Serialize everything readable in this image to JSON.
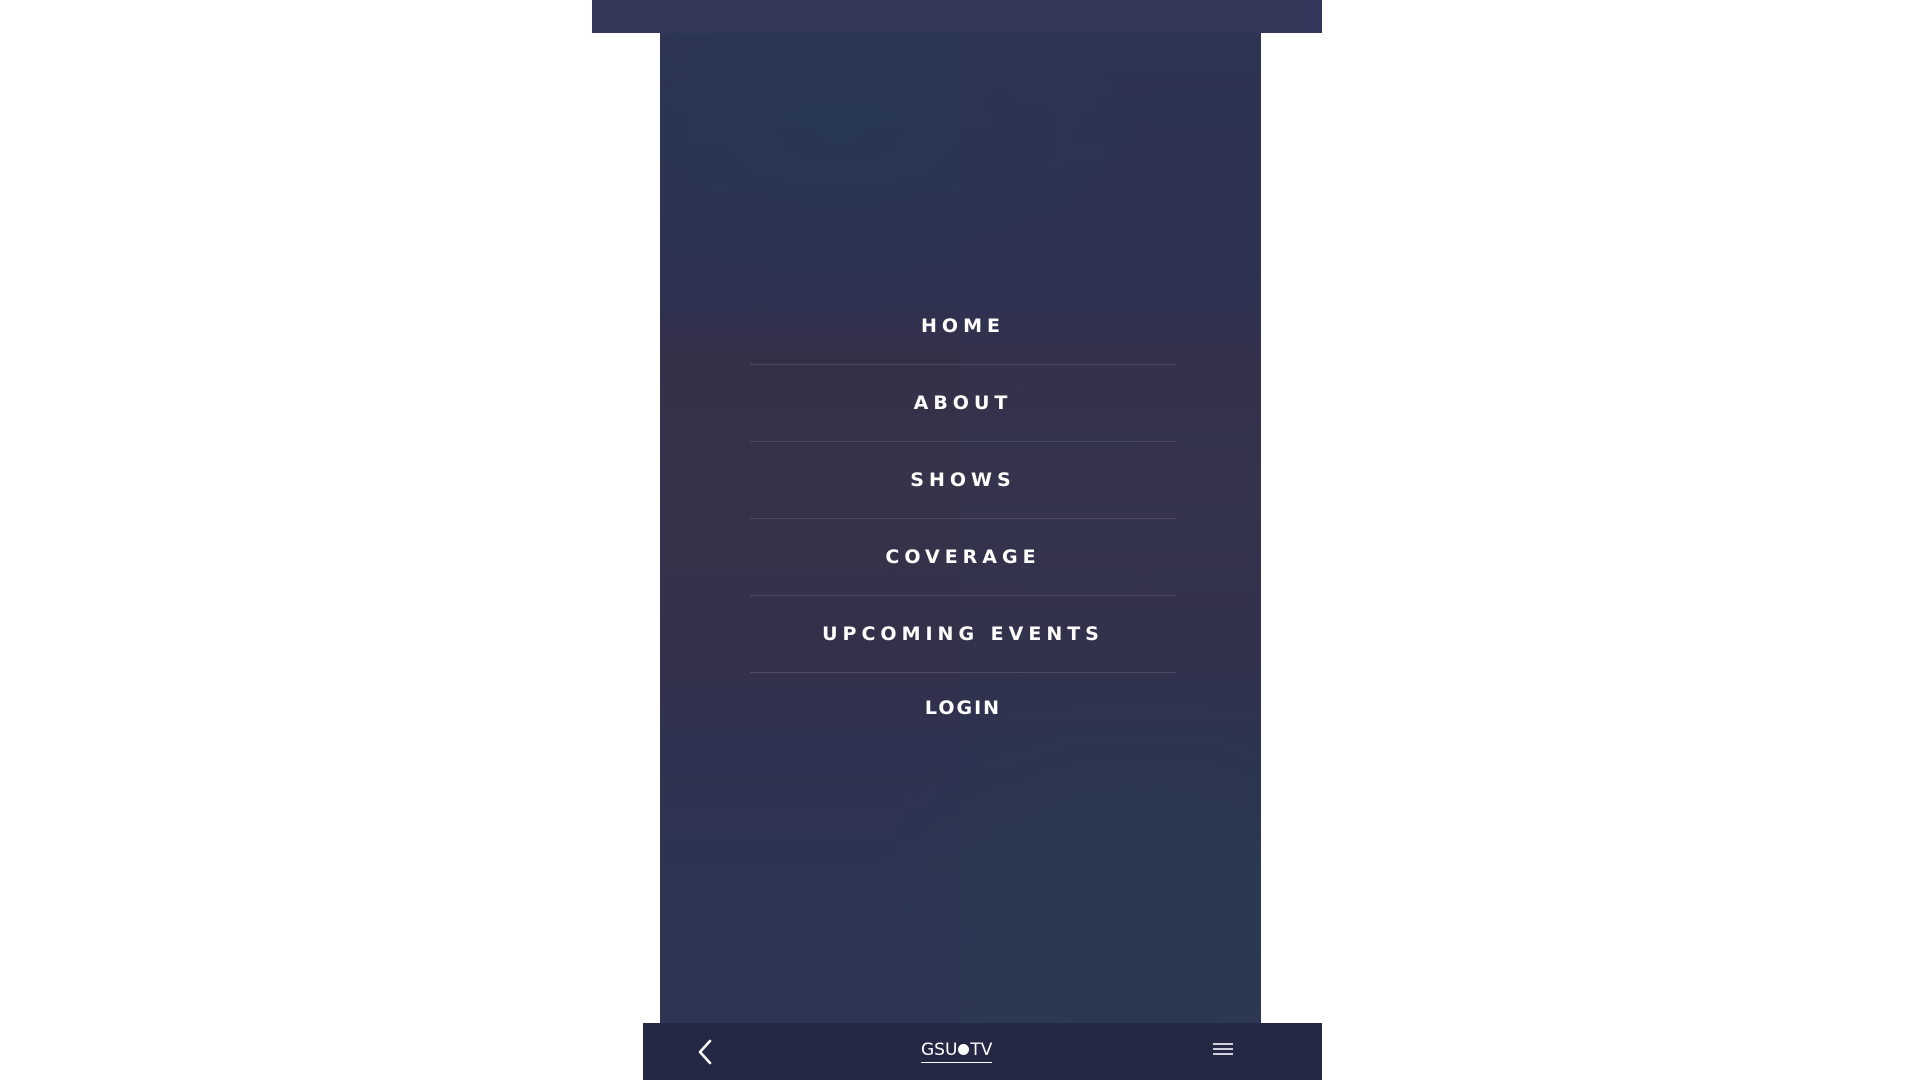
{
  "menu": {
    "items": [
      {
        "label": "HOME"
      },
      {
        "label": "ABOUT"
      },
      {
        "label": "SHOWS"
      },
      {
        "label": "COVERAGE"
      },
      {
        "label": "UPCOMING EVENTS"
      },
      {
        "label": "LOGIN"
      }
    ]
  },
  "bottom_bar": {
    "logo_left": "GSU",
    "logo_right": "TV",
    "back_icon": "chevron-left-icon",
    "menu_icon": "hamburger-icon"
  },
  "colors": {
    "top_bar": "#343759",
    "bottom_bar": "#252845",
    "menu_text": "#ffffff"
  }
}
